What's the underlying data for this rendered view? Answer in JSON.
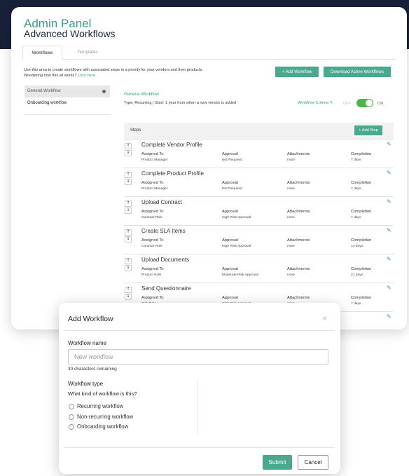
{
  "app": {
    "brand": "Admin Panel",
    "title": "Advanced Workflows"
  },
  "tabs": [
    {
      "label": "Workflows",
      "active": true
    },
    {
      "label": "Templates",
      "active": false
    }
  ],
  "intro": {
    "text": "Use this area to create workflows with associated steps in a priority for your vendors and their products. Wondering how this all works?",
    "link": "Click here."
  },
  "actions": {
    "add_workflow": "+ Add Workflow",
    "download": "Download Active Workflows"
  },
  "sidebar": {
    "items": [
      {
        "label": "General Workflow",
        "active": true
      },
      {
        "label": "Onboarding workflow",
        "active": false
      }
    ]
  },
  "workflow": {
    "name": "General Workflow",
    "type_line": "Type: Recurring | Start: 1 year from when a new vendor is added",
    "criteria_label": "Workflow Criteria",
    "toggle_off": "OFF",
    "toggle_on": "ON",
    "toggle_state": "on"
  },
  "steps_section": {
    "label": "Steps",
    "add_step": "+ Add Step"
  },
  "step_columns": {
    "assigned": "Assigned To",
    "approval": "Approval",
    "attachments": "Attachments",
    "completion": "Completion"
  },
  "steps": [
    {
      "title": "Complete Vendor Profile",
      "assigned": "Product Manager",
      "approval": "Not Required",
      "attachments": "none",
      "completion": "7 days"
    },
    {
      "title": "Complete Product Profile",
      "assigned": "Product Manager",
      "approval": "Not Required",
      "attachments": "none",
      "completion": "7 days"
    },
    {
      "title": "Upload Contract",
      "assigned": "Contract Role",
      "approval": "High Risk Approval",
      "attachments": "none",
      "completion": "7 days"
    },
    {
      "title": "Create SLA Items",
      "assigned": "Contract Role",
      "approval": "High Risk Approval",
      "attachments": "none",
      "completion": "14 days"
    },
    {
      "title": "Upload Documents",
      "assigned": "Product Role",
      "approval": "Moderate Risk Approval",
      "attachments": "none",
      "completion": "21 days"
    },
    {
      "title": "Send Questionnaire",
      "assigned": "Risk Role",
      "approval": "High Risk Approval",
      "attachments": "none",
      "completion": "7 days"
    }
  ],
  "modal": {
    "title": "Add Workflow",
    "close": "×",
    "name_label": "Workflow name",
    "name_placeholder": "New workflow",
    "remaining": "30 characters remaining",
    "type_label": "Workflow type",
    "type_question": "What kind of workflow is this?",
    "options": [
      "Recurring workflow",
      "Non-recurring workflow",
      "Onboarding workflow"
    ],
    "submit": "Submit",
    "cancel": "Cancel"
  },
  "colors": {
    "accent": "#4aa88f",
    "brand": "#3a9a88",
    "toggle": "#4fb54a",
    "header_band": "#18213a"
  }
}
